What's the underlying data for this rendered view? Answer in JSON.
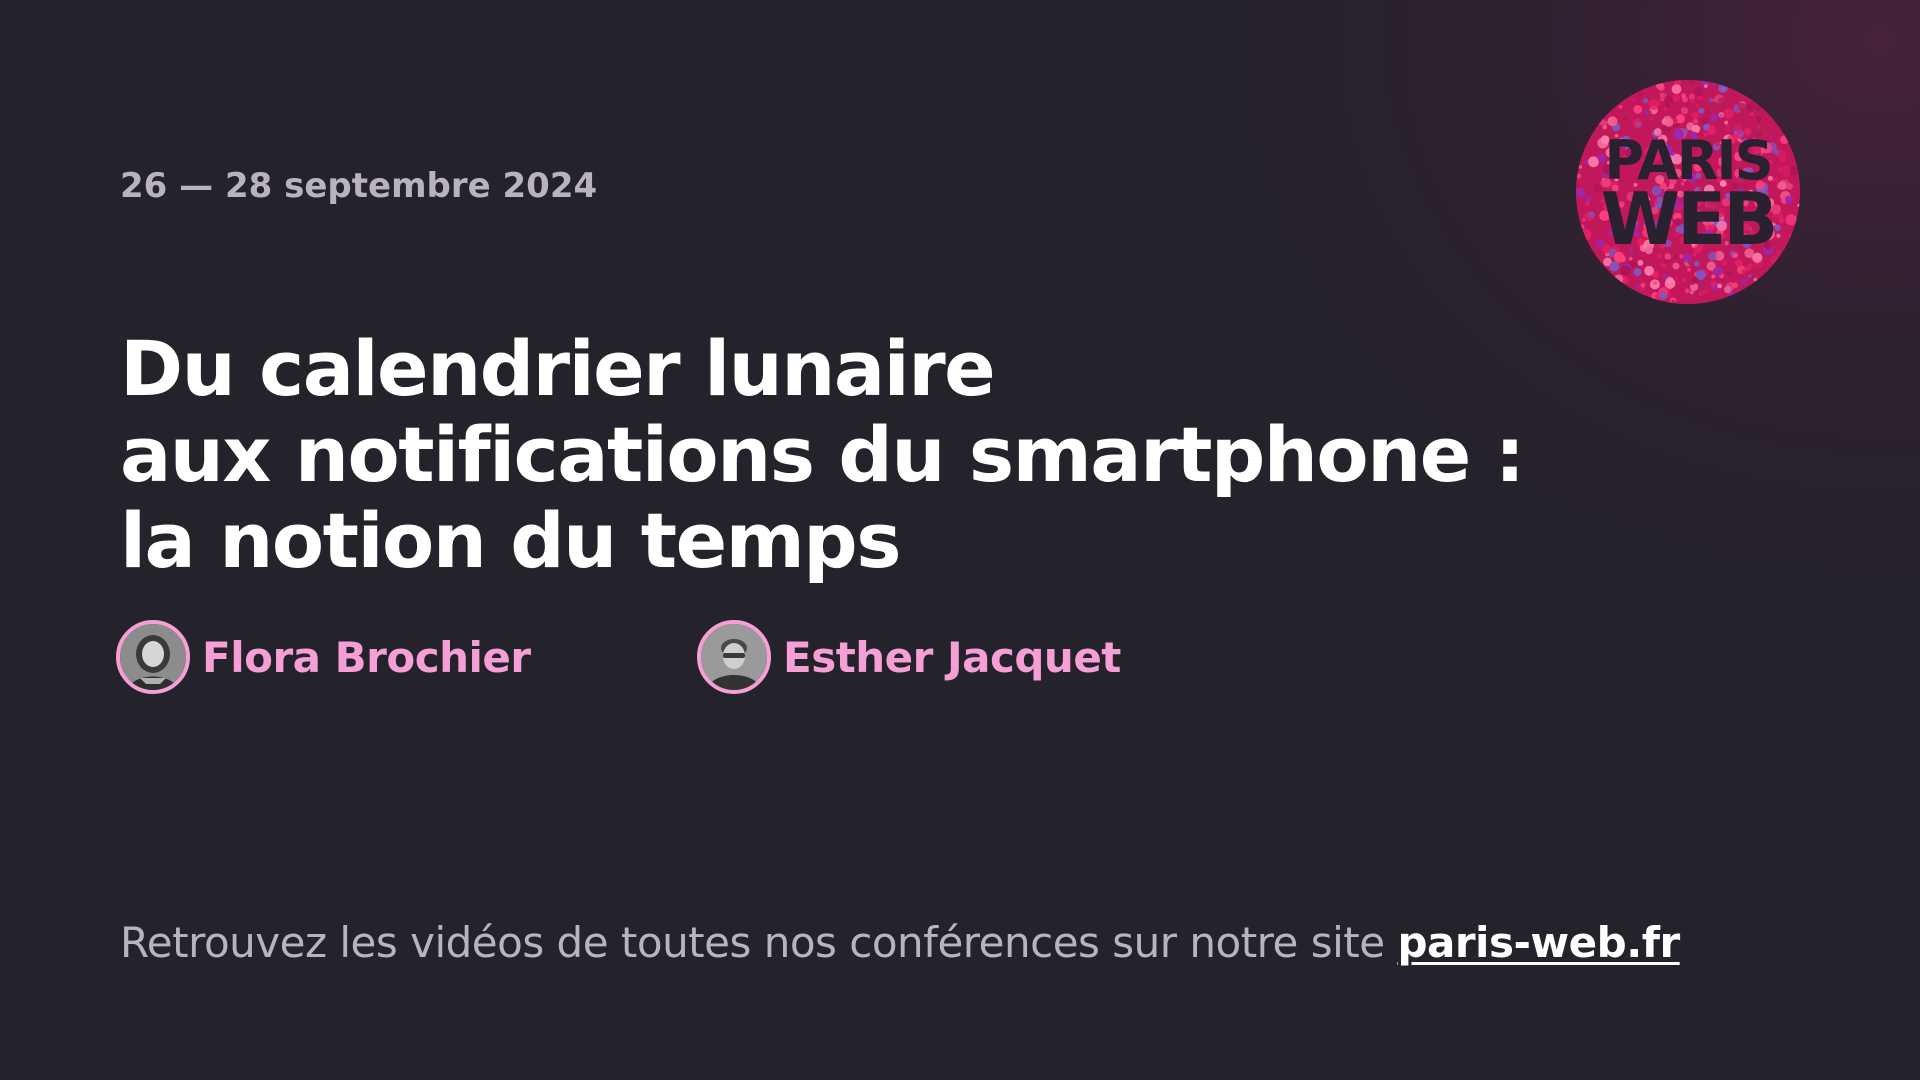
{
  "event": {
    "date_range": "26 — 28 septembre 2024",
    "logo_text_line1": "PARIS",
    "logo_text_line2": "WEB"
  },
  "talk": {
    "title_lines": [
      "Du calendrier lunaire",
      "aux notifications du smartphone :",
      "la notion du temps"
    ]
  },
  "speakers": [
    {
      "name": "Flora Brochier"
    },
    {
      "name": "Esther Jacquet"
    }
  ],
  "footer": {
    "text": "Retrouvez les vidéos de toutes nos conférences sur notre site",
    "link_label": "paris-web.fr"
  },
  "colors": {
    "background": "#24222b",
    "accent_pink": "#f59fd6",
    "muted_text": "#b8b3bd",
    "title_text": "#ffffff"
  }
}
